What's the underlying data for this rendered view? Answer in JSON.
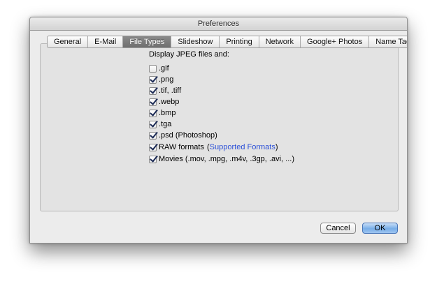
{
  "window": {
    "title": "Preferences"
  },
  "tabs": [
    {
      "label": "General",
      "active": false
    },
    {
      "label": "E-Mail",
      "active": false
    },
    {
      "label": "File Types",
      "active": true
    },
    {
      "label": "Slideshow",
      "active": false
    },
    {
      "label": "Printing",
      "active": false
    },
    {
      "label": "Network",
      "active": false
    },
    {
      "label": "Google+ Photos",
      "active": false
    },
    {
      "label": "Name Tags",
      "active": false
    }
  ],
  "file_types": {
    "heading": "Display JPEG files and:",
    "options": [
      {
        "label": ".gif",
        "checked": false
      },
      {
        "label": ".png",
        "checked": true
      },
      {
        "label": ".tif, .tiff",
        "checked": true
      },
      {
        "label": ".webp",
        "checked": true
      },
      {
        "label": ".bmp",
        "checked": true
      },
      {
        "label": ".tga",
        "checked": true
      },
      {
        "label": ".psd (Photoshop)",
        "checked": true
      },
      {
        "label": "RAW formats",
        "checked": true,
        "link_open": "(",
        "link": "Supported Formats",
        "link_close": ")"
      },
      {
        "label": "Movies (.mov, .mpg, .m4v, .3gp, .avi, ...)",
        "checked": true
      }
    ]
  },
  "buttons": {
    "cancel": "Cancel",
    "ok": "OK"
  },
  "colors": {
    "active_tab": "#7a7a7a",
    "link": "#2a4fd7",
    "default_button": "#78aee8"
  }
}
